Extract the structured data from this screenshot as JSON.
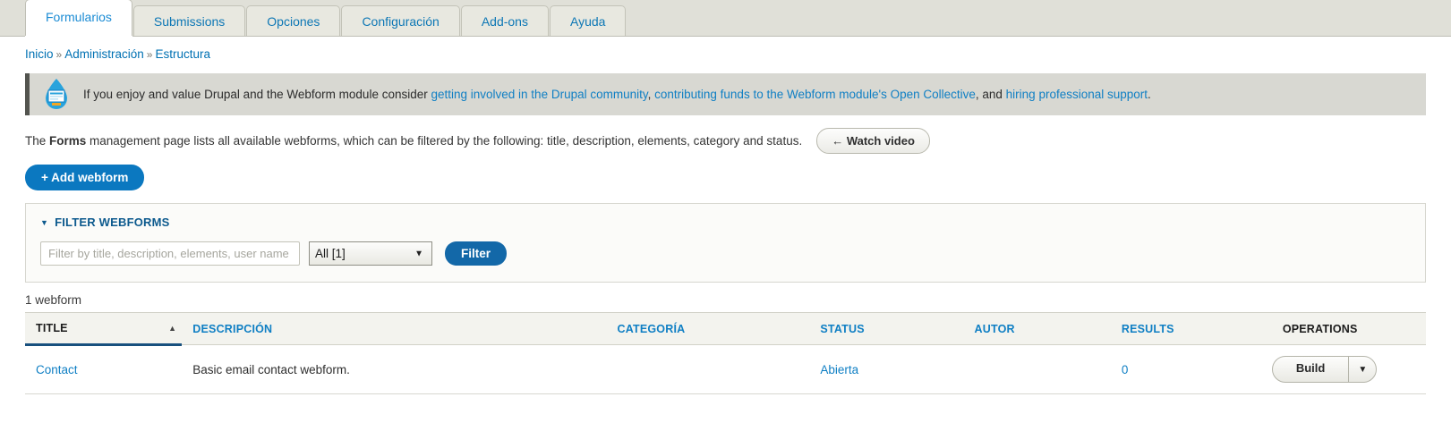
{
  "tabs": [
    {
      "label": "Formularios",
      "active": true
    },
    {
      "label": "Submissions",
      "active": false
    },
    {
      "label": "Opciones",
      "active": false
    },
    {
      "label": "Configuración",
      "active": false
    },
    {
      "label": "Add-ons",
      "active": false
    },
    {
      "label": "Ayuda",
      "active": false
    }
  ],
  "breadcrumb": {
    "items": [
      "Inicio",
      "Administración",
      "Estructura"
    ],
    "separator": "»"
  },
  "promo": {
    "icon": "drupal-droplet-icon",
    "text_before": "If you enjoy and value Drupal and the Webform module consider ",
    "link1": "getting involved in the Drupal community",
    "comma1": ", ",
    "link2": "contributing funds to the Webform module's Open Collective",
    "mid": ", and ",
    "link3": "hiring professional support",
    "text_end": ".",
    "accent_color": "#53544f",
    "background": "#d8d8d2"
  },
  "intro": {
    "text_before": "The ",
    "bold": "Forms",
    "text_after": " management page lists all available webforms, which can be filtered by the following: title, description, elements, category and status.",
    "watch_video_label": "← Watch video"
  },
  "actions": {
    "add_webform_label": "+ Add webform",
    "primary_color": "#0b78c0"
  },
  "filter": {
    "legend": "FILTER WEBFORMS",
    "caret": "▼",
    "input_placeholder": "Filter by title, description, elements, user name or role",
    "input_value": "",
    "select_value": "All [1]",
    "select_options": [
      "All [1]"
    ],
    "select_arrow": "▼",
    "filter_button_label": "Filter"
  },
  "results": {
    "count_label": "1 webform",
    "columns": [
      {
        "label": "TITLE",
        "sorted": true,
        "sort_arrow": "▲",
        "link": false
      },
      {
        "label": "DESCRIPCIÓN",
        "sorted": false,
        "link": true
      },
      {
        "label": "CATEGORÍA",
        "sorted": false,
        "link": true
      },
      {
        "label": "STATUS",
        "sorted": false,
        "link": true
      },
      {
        "label": "AUTOR",
        "sorted": false,
        "link": true
      },
      {
        "label": "RESULTS",
        "sorted": false,
        "link": true
      },
      {
        "label": "OPERATIONS",
        "sorted": false,
        "link": false
      }
    ],
    "rows": [
      {
        "title": "Contact",
        "description": "Basic email contact webform.",
        "category": "",
        "status": "Abierta",
        "author": "",
        "results": "0",
        "operation_label": "Build",
        "operation_toggle": "▼"
      }
    ]
  }
}
